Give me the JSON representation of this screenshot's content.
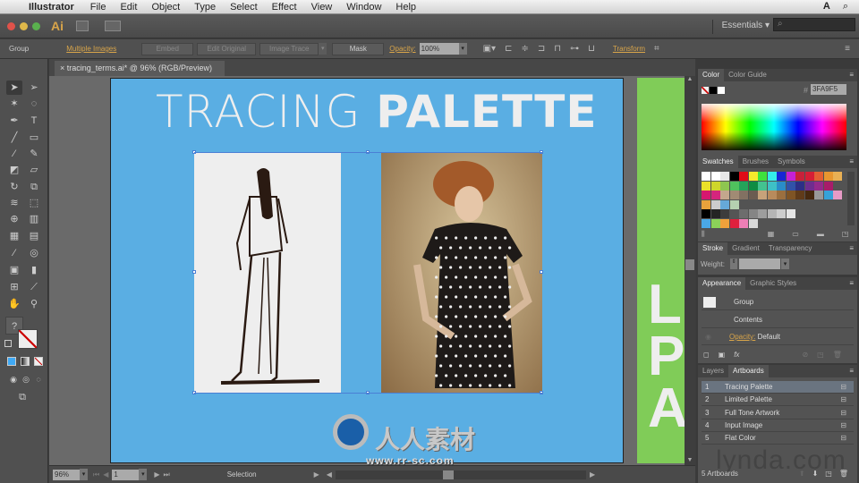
{
  "menubar": {
    "app": "Illustrator",
    "items": [
      "File",
      "Edit",
      "Object",
      "Type",
      "Select",
      "Effect",
      "View",
      "Window",
      "Help"
    ]
  },
  "appbar": {
    "logo": "Ai",
    "workspace": "Essentials",
    "workspace_caret": "▾",
    "search_placeholder": "⌕"
  },
  "control": {
    "selection_label": "Group",
    "link_label": "Multiple Images",
    "buttons": [
      "Embed",
      "Edit Original",
      "Image Trace",
      "Mask"
    ],
    "opacity_label": "Opacity:",
    "opacity_value": "100%",
    "transform_label": "Transform"
  },
  "document": {
    "tab_label": "tracing_terms.ai* @ 96% (RGB/Preview)",
    "close_glyph": "×",
    "artboard_title_light": "TRACING ",
    "artboard_title_bold": "PALETTE",
    "artboard2_text": "L\nP\nA"
  },
  "status": {
    "zoom": "96%",
    "page": "1",
    "tool": "Selection"
  },
  "color_panel": {
    "tabs": [
      "Color",
      "Color Guide"
    ],
    "hex_label": "#",
    "hex_value": "3FA9F5"
  },
  "swatches_panel": {
    "tabs": [
      "Swatches",
      "Brushes",
      "Symbols"
    ],
    "colors": [
      [
        "#ffffff",
        "#ffffff",
        "#e8e8e8",
        "#000000",
        "#e10b17",
        "#f5e92c",
        "#3ee13d",
        "#34ece9",
        "#1726d4",
        "#c521d6",
        "#c8213a",
        "#d61e36",
        "#e35e33",
        "#e8962f",
        "#e9b054"
      ],
      [
        "#ebe02a",
        "#cfd62b",
        "#8ec650",
        "#4fc15d",
        "#25a35a",
        "#0f8c43",
        "#43c290",
        "#3ec0c6",
        "#2a8cc8",
        "#3152a8",
        "#2d2f86",
        "#6e2d8f",
        "#942a8b",
        "#a81c6a"
      ],
      [
        "#d6176f",
        "#d4257d",
        "#c4a78d",
        "#a18b74",
        "#827162",
        "#6b5b50",
        "#c7a27a",
        "#b88b5c",
        "#9b6f3f",
        "#7f5425",
        "#603b1a",
        "#47290f",
        "#999999",
        "#36a2d9",
        "#e79ac6"
      ],
      [
        "#e9a23c",
        "#cccccc",
        "#66a8d8",
        "#b5d0b0"
      ],
      [
        "#000000",
        "#242424",
        "#3c3c3c",
        "#555555",
        "#6d6d6d",
        "#858585",
        "#9d9d9d",
        "#b5b5b5",
        "#cdcdcd",
        "#e5e5e5"
      ],
      [
        "#4aa8e6",
        "#8bd159",
        "#f0a13b",
        "#e0203d",
        "#ee7fb6",
        "#d9d9d9"
      ]
    ]
  },
  "stroke_panel": {
    "tabs": [
      "Stroke",
      "Gradient",
      "Transparency"
    ],
    "weight_label": "Weight:"
  },
  "appearance_panel": {
    "tabs": [
      "Appearance",
      "Graphic Styles"
    ],
    "rows": [
      "Group",
      "Contents"
    ],
    "opacity_label": "Opacity:",
    "opacity_value": "Default",
    "fx_label": "fx"
  },
  "artboards_panel": {
    "tabs": [
      "Layers",
      "Artboards"
    ],
    "items": [
      {
        "num": "1",
        "name": "Tracing Palette"
      },
      {
        "num": "2",
        "name": "Limited Palette"
      },
      {
        "num": "3",
        "name": "Full Tone Artwork"
      },
      {
        "num": "4",
        "name": "Input Image"
      },
      {
        "num": "5",
        "name": "Flat Color"
      }
    ],
    "footer_label": "5 Artboards"
  },
  "watermarks": {
    "lynda": "lynda.com",
    "rrsc_cn": "人人素材",
    "rrsc_url": "www.rr-sc.com"
  }
}
